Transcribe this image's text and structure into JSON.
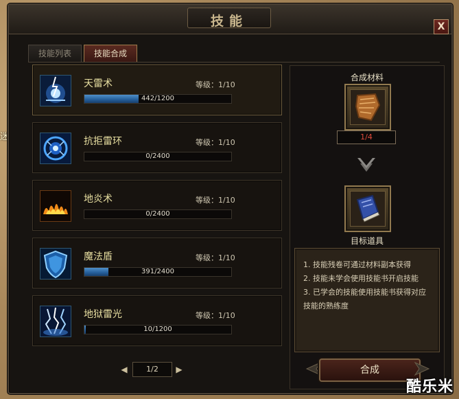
{
  "window": {
    "title": "技能",
    "close_label": "X"
  },
  "tabs": [
    {
      "label": "技能列表",
      "active": false
    },
    {
      "label": "技能合成",
      "active": true
    }
  ],
  "skills": [
    {
      "name": "天雷术",
      "level_label": "等级：",
      "level": "1/10",
      "progress_text": "442/1200",
      "progress": 0.368,
      "icon": "lightning-orb-icon",
      "selected": true
    },
    {
      "name": "抗拒雷环",
      "level_label": "等级：",
      "level": "1/10",
      "progress_text": "0/2400",
      "progress": 0,
      "icon": "thunder-ring-icon",
      "selected": false
    },
    {
      "name": "地炎术",
      "level_label": "等级：",
      "level": "1/10",
      "progress_text": "0/2400",
      "progress": 0,
      "icon": "ground-flame-icon",
      "selected": false
    },
    {
      "name": "魔法盾",
      "level_label": "等级：",
      "level": "1/10",
      "progress_text": "391/2400",
      "progress": 0.163,
      "icon": "magic-shield-icon",
      "selected": false
    },
    {
      "name": "地狱雷光",
      "level_label": "等级：",
      "level": "1/10",
      "progress_text": "10/1200",
      "progress": 0.008,
      "icon": "hell-lightning-icon",
      "selected": false
    }
  ],
  "pager": {
    "text": "1/2",
    "prev": "◀",
    "next": "▶"
  },
  "synthesis": {
    "material_label": "合成材料",
    "material_icon": "skill-fragment-icon",
    "material_count": "1/4",
    "target_label": "目标道具",
    "target_icon": "skill-book-icon",
    "description": [
      "1. 技能残卷可通过材料副本获得",
      "2. 技能未学会使用技能书开启技能",
      "3. 已学会的技能使用技能书获得对应",
      "技能的熟练度"
    ],
    "combine_label": "合成"
  },
  "side_text": "迷",
  "watermark": "酷乐米",
  "colors": {
    "progress": "#2f6fae",
    "count_text": "#e04a3a",
    "skill_name": "#e8dfa1"
  }
}
